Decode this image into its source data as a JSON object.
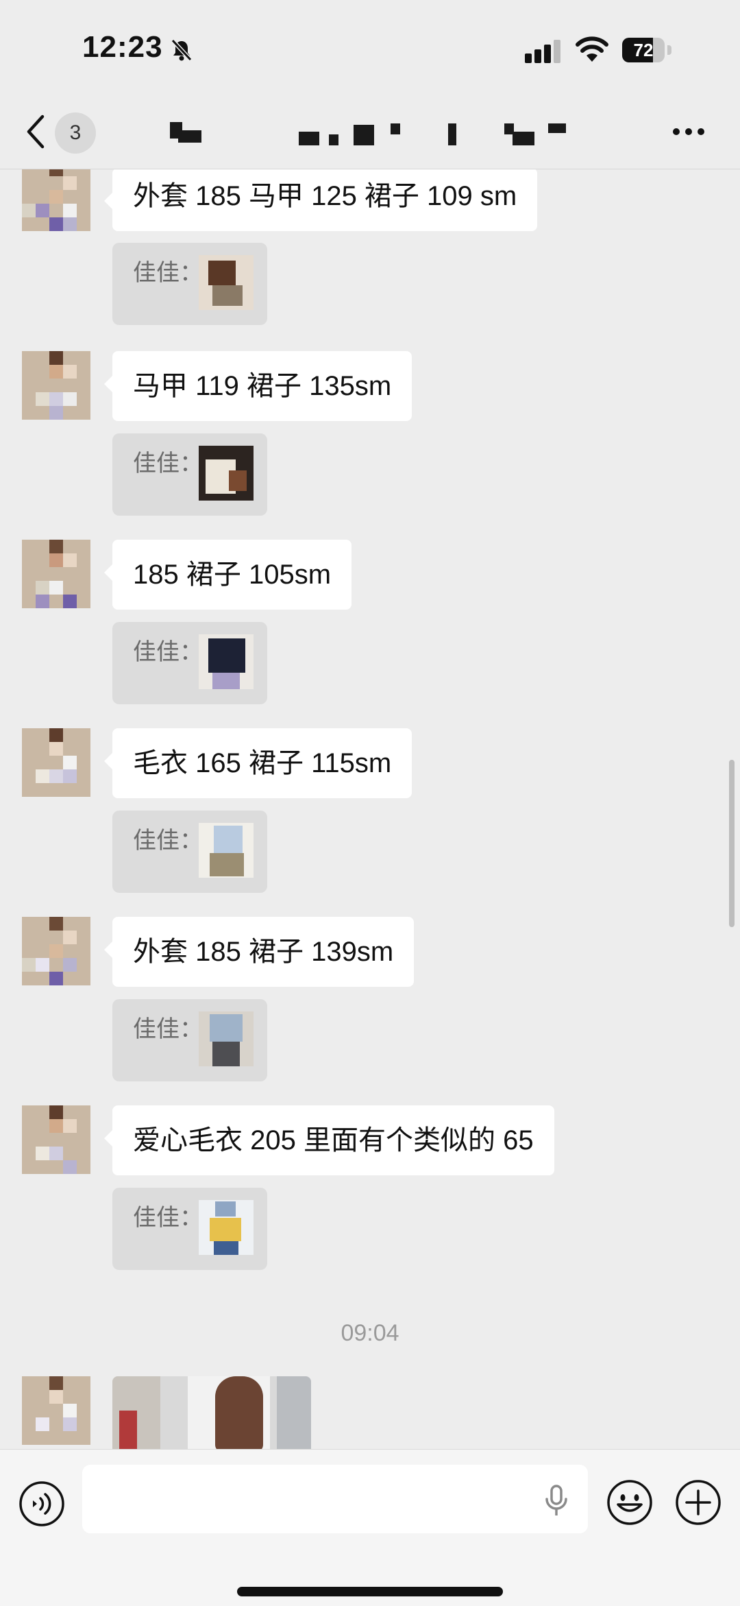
{
  "status_bar": {
    "time": "12:23",
    "battery": "72",
    "battery_level": 0.72,
    "icons": [
      "bell-slash-icon",
      "cellular-signal-icon",
      "wifi-icon",
      "battery-icon"
    ]
  },
  "header": {
    "unread_count": "3",
    "icons": [
      "chevron-left-icon",
      "more-icon"
    ]
  },
  "messages": [
    {
      "text": "外套 185 马甲 125 裙子 109 sm",
      "quote_label": "佳佳："
    },
    {
      "text": "马甲 119 裙子 135sm",
      "quote_label": "佳佳："
    },
    {
      "text": "185 裙子 105sm",
      "quote_label": "佳佳："
    },
    {
      "text": "毛衣 165 裙子 115sm",
      "quote_label": "佳佳："
    },
    {
      "text": "外套 185 裙子 139sm",
      "quote_label": "佳佳："
    },
    {
      "text": "爱心毛衣 205 里面有个类似的 65",
      "quote_label": "佳佳："
    }
  ],
  "timestamp": "09:04",
  "input_bar": {
    "icons": [
      "voice-input-icon",
      "microphone-icon",
      "emoji-icon",
      "plus-icon"
    ]
  },
  "colors": {
    "background": "#ededed",
    "bubble": "#ffffff",
    "quote": "#dcdcdc",
    "timestamp": "#9a9a9a"
  }
}
